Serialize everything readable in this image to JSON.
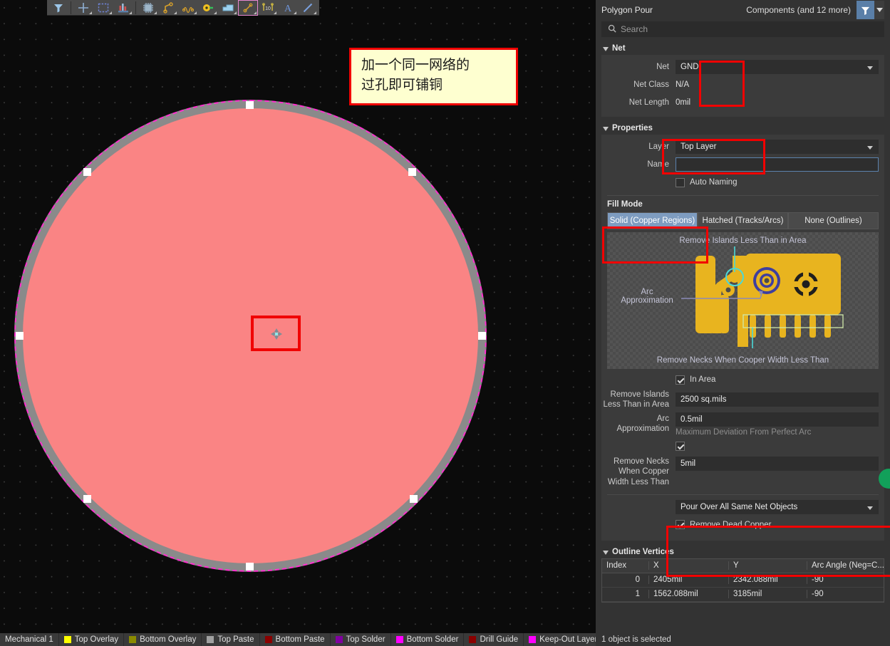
{
  "toolbar": {
    "items": [
      {
        "name": "filter-funnel-icon",
        "label": "Filter"
      },
      {
        "name": "crosshair-icon",
        "label": "Place Crosshair"
      },
      {
        "name": "marquee-select-icon",
        "label": "Marquee Select"
      },
      {
        "name": "bar-chart-icon",
        "label": "Reports"
      },
      {
        "name": "component-chip-icon",
        "label": "Place Component"
      },
      {
        "name": "route-track-icon",
        "label": "Interactive Routing"
      },
      {
        "name": "differential-pair-icon",
        "label": "Differential Pair Routing"
      },
      {
        "name": "pad-icon",
        "label": "Place Pad"
      },
      {
        "name": "fill-region-icon",
        "label": "Place Fill"
      },
      {
        "name": "polygon-pour-icon",
        "label": "Place Polygon Pour"
      },
      {
        "name": "dimension-icon",
        "label": "Place Dimension"
      },
      {
        "name": "text-string-icon",
        "label": "Place String"
      },
      {
        "name": "line-icon",
        "label": "Place Line"
      }
    ]
  },
  "canvas": {
    "note_line1": "加一个同一网络的",
    "note_line2": "过孔即可铺铜",
    "polygon_name": "polygon-pour-circle"
  },
  "layer_tabs": [
    {
      "label": "Mechanical 1",
      "color": null
    },
    {
      "label": "Top Overlay",
      "color": "#ffff00"
    },
    {
      "label": "Bottom Overlay",
      "color": "#8a8a00"
    },
    {
      "label": "Top Paste",
      "color": "#a0a0a0"
    },
    {
      "label": "Bottom Paste",
      "color": "#8a0000"
    },
    {
      "label": "Top Solder",
      "color": "#8000a0"
    },
    {
      "label": "Bottom Solder",
      "color": "#ff00ff"
    },
    {
      "label": "Drill Guide",
      "color": "#8a0000"
    },
    {
      "label": "Keep-Out Layer",
      "color": "#ff00ff"
    }
  ],
  "panel": {
    "title": "Polygon Pour",
    "scope": "Components (and 12 more)",
    "filter_icon": "filter-funnel-icon",
    "search": {
      "placeholder": "Search",
      "value": "",
      "icon": "search-icon"
    },
    "net_section": {
      "title": "Net",
      "net_label": "Net",
      "net_value": "GND",
      "net_class_label": "Net Class",
      "net_class_value": "N/A",
      "net_length_label": "Net Length",
      "net_length_value": "0mil"
    },
    "properties_section": {
      "title": "Properties",
      "layer_label": "Layer",
      "layer_value": "Top Layer",
      "name_label": "Name",
      "name_value": "",
      "auto_naming_label": "Auto Naming",
      "auto_naming_checked": false
    },
    "fill_mode": {
      "title": "Fill Mode",
      "options": [
        "Solid (Copper Regions)",
        "Hatched (Tracks/Arcs)",
        "None (Outlines)"
      ],
      "selected_index": 0
    },
    "preview": {
      "top_label": "Remove Islands Less Than in Area",
      "left_label_line1": "Arc",
      "left_label_line2": "Approximation",
      "bottom_label": "Remove Necks When Cooper Width Less Than"
    },
    "fill_options": {
      "in_area_label": "In Area",
      "in_area_checked": true,
      "remove_islands_label_line1": "Remove Islands",
      "remove_islands_label_line2": "Less Than in Area",
      "remove_islands_value": "2500 sq.mils",
      "arc_label_line1": "Arc",
      "arc_label_line2": "Approximation",
      "arc_value": "0.5mil",
      "arc_hint": "Maximum Deviation From Perfect Arc",
      "necks_checked": true,
      "necks_label_line1": "Remove Necks",
      "necks_label_line2": "When Copper",
      "necks_label_line3": "Width Less Than",
      "necks_value": "5mil",
      "pour_over_value": "Pour Over All Same Net Objects",
      "remove_dead_copper_label": "Remove Dead Copper",
      "remove_dead_copper_checked": true
    },
    "outline_vertices": {
      "title": "Outline Vertices",
      "columns": [
        "Index",
        "X",
        "Y",
        "Arc Angle (Neg=C..."
      ],
      "rows": [
        {
          "index": "0",
          "x": "2405mil",
          "y": "2342.088mil",
          "arc": "-90"
        },
        {
          "index": "1",
          "x": "1562.088mil",
          "y": "3185mil",
          "arc": "-90"
        }
      ]
    },
    "status": "1 object is selected"
  },
  "colors": {
    "accent_blue": "#7e9cc0",
    "highlight_red": "#f20000",
    "copper_fill": "#fa8484",
    "keepout_magenta": "#ff2fd0",
    "note_yellow": "#feffd0",
    "green_badge": "#12a05a"
  }
}
